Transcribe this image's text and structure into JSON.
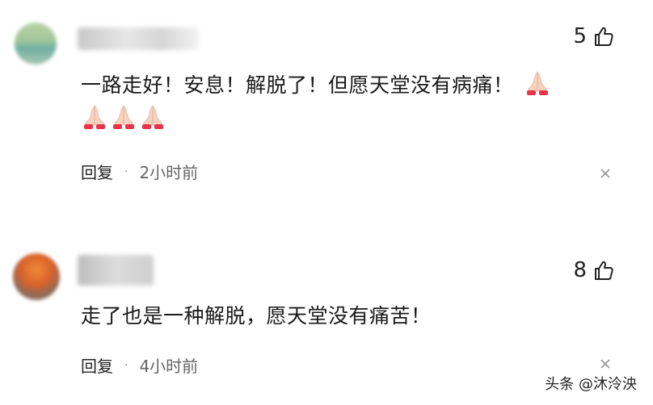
{
  "comments": [
    {
      "likes": "5",
      "text_line1": "一路走好！安息！解脱了！但愿天堂没有病痛！",
      "reply_label": "回复",
      "separator": "·",
      "time": "2小时前"
    },
    {
      "likes": "8",
      "text_line1": "走了也是一种解脱，愿天堂没有痛苦！",
      "reply_label": "回复",
      "separator": "·",
      "time": "4小时前"
    }
  ],
  "watermark": "头条 @沐泠泱",
  "colors": {
    "text": "#1a1a1a",
    "meta": "#666666",
    "emoji_fill": "#f7d2bf",
    "emoji_cuff": "#e8334a"
  },
  "icons": [
    "thumbs-up-icon",
    "close-icon",
    "folded-hands-emoji",
    "avatar"
  ]
}
